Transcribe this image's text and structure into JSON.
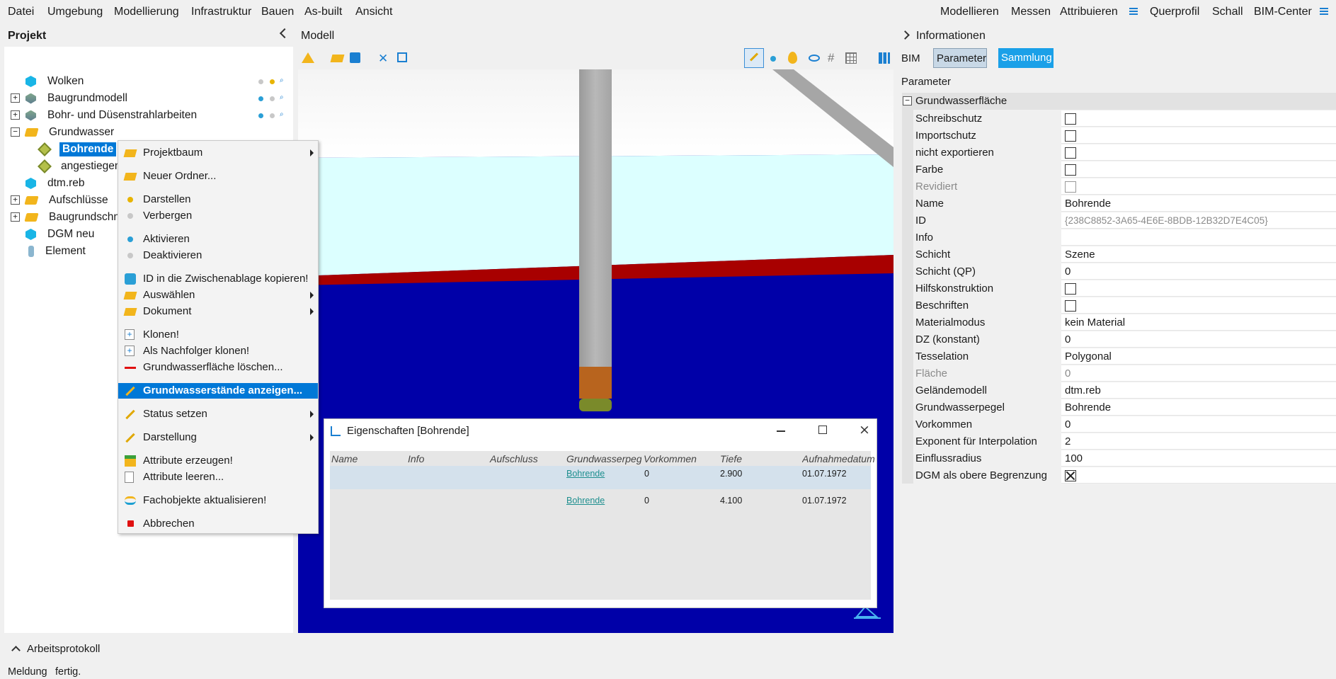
{
  "menubar": {
    "left": [
      "Datei",
      "Umgebung",
      "Modellierung",
      "Infrastruktur",
      "Bauen",
      "As-built",
      "Ansicht"
    ],
    "right": [
      "Modellieren",
      "Messen",
      "Attribuieren",
      "Querprofil",
      "Schall",
      "BIM-Center"
    ]
  },
  "left_panel": {
    "title": "Projekt",
    "tree": [
      {
        "label": "Wolken"
      },
      {
        "label": "Baugrundmodell"
      },
      {
        "label": "Bohr- und Düsenstrahlarbeiten"
      },
      {
        "label": "Grundwasser"
      },
      {
        "label": "Bohrende"
      },
      {
        "label": "angestiegen"
      },
      {
        "label": "dtm.reb"
      },
      {
        "label": "Aufschlüsse"
      },
      {
        "label": "Baugrundschnitt"
      },
      {
        "label": "DGM neu"
      },
      {
        "label": "Element"
      }
    ]
  },
  "model_panel": {
    "title": "Modell"
  },
  "context_menu": {
    "items": [
      {
        "label": "Projektbaum",
        "icon": "folder-icon"
      },
      {
        "label": "Neuer Ordner...",
        "icon": "folder-icon"
      },
      {
        "label": "Darstellen",
        "icon": "dot-yellow-icon"
      },
      {
        "label": "Verbergen",
        "icon": "dot-grey-icon"
      },
      {
        "label": "Aktivieren",
        "icon": "dot-blue-icon"
      },
      {
        "label": "Deaktivieren",
        "icon": "dot-grey-icon"
      },
      {
        "label": "ID in die Zwischenablage kopieren!",
        "icon": "puzzle-icon"
      },
      {
        "label": "Auswählen",
        "icon": "folder-icon"
      },
      {
        "label": "Dokument",
        "icon": "folder-icon"
      },
      {
        "label": "Klonen!",
        "icon": "clone-icon"
      },
      {
        "label": "Als Nachfolger klonen!",
        "icon": "clone-icon"
      },
      {
        "label": "Grundwasserfläche löschen...",
        "icon": "minus-icon"
      },
      {
        "label": "Grundwasserstände anzeigen...",
        "icon": "pencil-icon"
      },
      {
        "label": "Status setzen",
        "icon": "pencil-icon"
      },
      {
        "label": "Darstellung",
        "icon": "pencil-icon"
      },
      {
        "label": "Attribute erzeugen!",
        "icon": "table-icon"
      },
      {
        "label": "Attribute leeren...",
        "icon": "page-icon"
      },
      {
        "label": "Fachobjekte aktualisieren!",
        "icon": "waves-icon"
      },
      {
        "label": "Abbrechen",
        "icon": "stop-icon"
      }
    ]
  },
  "dialog": {
    "title": "Eigenschaften [Bohrende]",
    "columns": [
      "Name",
      "Info",
      "Aufschluss",
      "Grundwasserpegel",
      "Vorkommen",
      "Tiefe",
      "Aufnahmedatum"
    ],
    "rows": [
      {
        "grundwasserpegel": "Bohrende",
        "vorkommen": "0",
        "tiefe": "2.900",
        "datum": "01.07.1972"
      },
      {
        "grundwasserpegel": "Bohrende",
        "vorkommen": "0",
        "tiefe": "4.100",
        "datum": "01.07.1972"
      }
    ]
  },
  "right_panel": {
    "title": "Informationen",
    "tabs": [
      "BIM",
      "Parameter",
      "Sammlung"
    ],
    "section_label": "Parameter",
    "group": "Grundwasserfläche",
    "rows": [
      {
        "label": "Schreibschutz",
        "checkbox": true
      },
      {
        "label": "Importschutz",
        "checkbox": true
      },
      {
        "label": "nicht exportieren",
        "checkbox": true
      },
      {
        "label": "Farbe",
        "checkbox": true
      },
      {
        "label": "Revidiert",
        "checkbox": true
      },
      {
        "label": "Name",
        "value": "Bohrende"
      },
      {
        "label": "ID",
        "value": "{238C8852-3A65-4E6E-8BDB-12B32D7E4C05}"
      },
      {
        "label": "Info",
        "value": ""
      },
      {
        "label": "Schicht",
        "value": "Szene"
      },
      {
        "label": "Schicht (QP)",
        "value": "0"
      },
      {
        "label": "Hilfskonstruktion",
        "checkbox": true
      },
      {
        "label": "Beschriften",
        "checkbox": true
      },
      {
        "label": "Materialmodus",
        "value": "kein Material"
      },
      {
        "label": "DZ (konstant)",
        "value": "0"
      },
      {
        "label": "Tesselation",
        "value": "Polygonal"
      },
      {
        "label": "Fläche",
        "value": "0"
      },
      {
        "label": "Geländemodell",
        "value": "dtm.reb"
      },
      {
        "label": "Grundwasserpegel",
        "value": "Bohrende"
      },
      {
        "label": "Vorkommen",
        "value": "0"
      },
      {
        "label": "Exponent für Interpolation",
        "value": "2"
      },
      {
        "label": "Einflussradius",
        "value": "100"
      },
      {
        "label": "DGM als obere Begrenzung",
        "checkbox": true,
        "checked": true
      }
    ]
  },
  "bottom": {
    "log_title": "Arbeitsprotokoll",
    "message_label": "Meldung",
    "message_text": "fertig."
  },
  "colors": {
    "accent": "#0078d7",
    "viewport_blue": "#0000a8",
    "groundwater_red": "#a80000",
    "sky_cyan": "#dcffff"
  }
}
